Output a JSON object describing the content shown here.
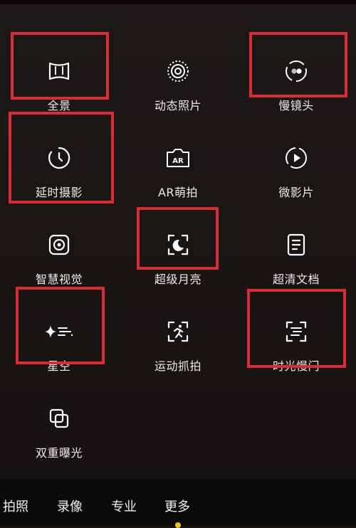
{
  "modes": [
    {
      "label": "全景",
      "icon": "panorama-icon"
    },
    {
      "label": "动态照片",
      "icon": "live-photo-icon"
    },
    {
      "label": "慢镜头",
      "icon": "slow-motion-icon"
    },
    {
      "label": "延时摄影",
      "icon": "timelapse-icon"
    },
    {
      "label": "AR萌拍",
      "icon": "ar-icon"
    },
    {
      "label": "微影片",
      "icon": "micro-movie-icon"
    },
    {
      "label": "智慧视觉",
      "icon": "smart-vision-icon"
    },
    {
      "label": "超级月亮",
      "icon": "super-moon-icon"
    },
    {
      "label": "超清文档",
      "icon": "document-icon"
    },
    {
      "label": "星空",
      "icon": "starry-sky-icon"
    },
    {
      "label": "运动抓拍",
      "icon": "sport-capture-icon"
    },
    {
      "label": "时光慢门",
      "icon": "light-painting-icon"
    },
    {
      "label": "双重曝光",
      "icon": "double-exposure-icon"
    }
  ],
  "highlighted_modes": [
    "全景",
    "慢镜头",
    "延时摄影",
    "超级月亮",
    "星空",
    "时光慢门"
  ],
  "tabs": [
    {
      "label": "拍照"
    },
    {
      "label": "录像"
    },
    {
      "label": "专业"
    },
    {
      "label": "更多"
    }
  ],
  "active_tab": "更多",
  "colors": {
    "highlight": "#dc2b33",
    "active_indicator": "#f5c518",
    "background": "#1a1614"
  }
}
